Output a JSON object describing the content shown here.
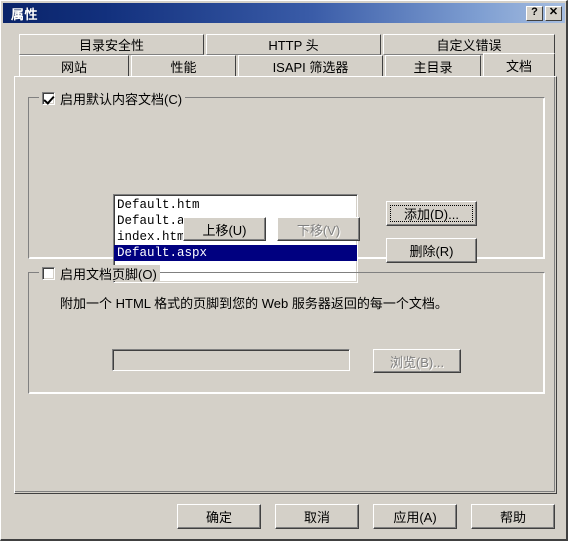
{
  "window": {
    "title": "属性",
    "help_button": "?",
    "close_button": "✕",
    "help_icon_name": "help-icon",
    "close_icon_name": "close-icon",
    "title_gradient_start": "#0a246a",
    "title_gradient_end": "#a6bde0",
    "face_color": "#d4d0c8"
  },
  "tabs": {
    "row1": [
      {
        "label": "目录安全性"
      },
      {
        "label": "HTTP 头"
      },
      {
        "label": "自定义错误"
      }
    ],
    "row2": [
      {
        "label": "网站"
      },
      {
        "label": "性能"
      },
      {
        "label": "ISAPI 筛选器"
      },
      {
        "label": "主目录"
      },
      {
        "label": "文档",
        "active": true
      }
    ],
    "active_label": "文档"
  },
  "documents_group": {
    "checkbox_label": "启用默认内容文档(C)",
    "checked": true,
    "list": {
      "items": [
        {
          "name": "Default.htm",
          "selected": false
        },
        {
          "name": "Default.asp",
          "selected": false
        },
        {
          "name": "index.htm",
          "selected": false
        },
        {
          "name": "Default.aspx",
          "selected": true
        }
      ],
      "selection_color": "#000080"
    },
    "add_button": "添加(D)...",
    "remove_button": "删除(R)",
    "move_up_button": "上移(U)",
    "move_down_button": "下移(V)",
    "move_down_disabled": true,
    "add_button_focused": true
  },
  "footer_group": {
    "checkbox_label": "启用文档页脚(O)",
    "checked": false,
    "description": "附加一个 HTML 格式的页脚到您的 Web 服务器返回的每一个文档。",
    "path_value": "",
    "path_disabled": true,
    "browse_button": "浏览(B)...",
    "browse_disabled": true
  },
  "dialog_buttons": {
    "ok": "确定",
    "cancel": "取消",
    "apply": "应用(A)",
    "help": "帮助"
  }
}
